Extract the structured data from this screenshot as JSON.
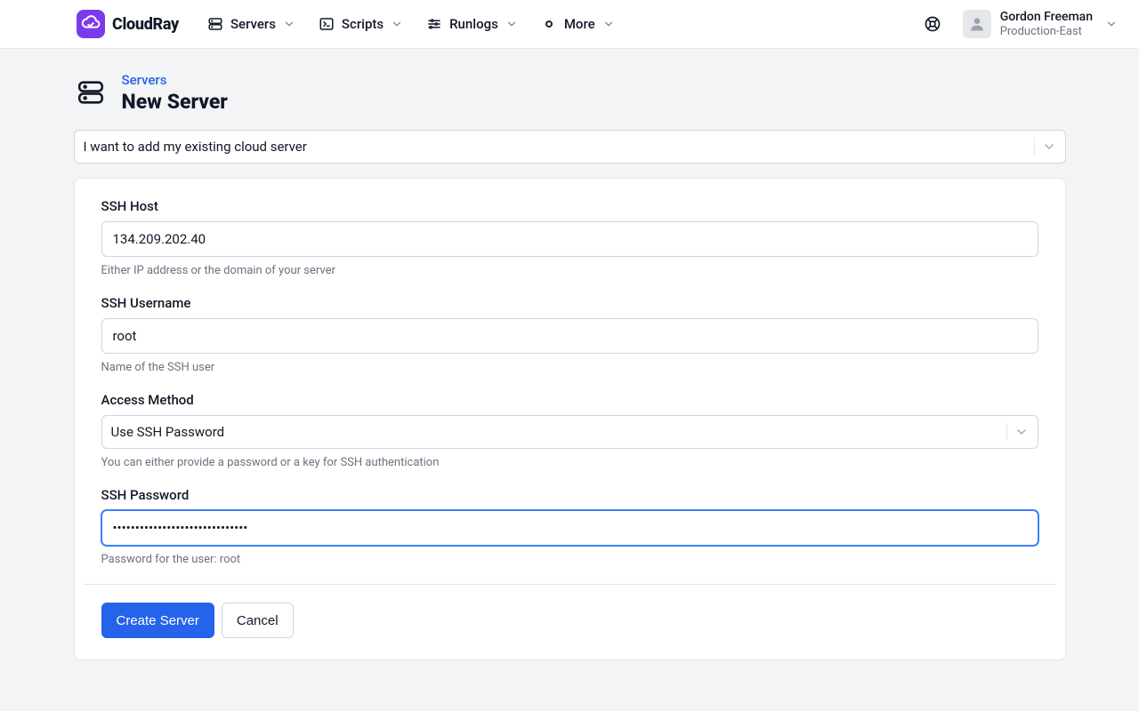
{
  "brand": {
    "name": "CloudRay"
  },
  "nav": {
    "servers": "Servers",
    "scripts": "Scripts",
    "runlogs": "Runlogs",
    "more": "More"
  },
  "user": {
    "name": "Gordon Freeman",
    "workspace": "Production-East"
  },
  "breadcrumb": {
    "servers": "Servers"
  },
  "page": {
    "title": "New Server"
  },
  "serverTypeSelector": {
    "value": "I want to add my existing cloud server"
  },
  "form": {
    "sshHost": {
      "label": "SSH Host",
      "value": "134.209.202.40",
      "help": "Either IP address or the domain of your server"
    },
    "sshUsername": {
      "label": "SSH Username",
      "value": "root",
      "help": "Name of the SSH user"
    },
    "accessMethod": {
      "label": "Access Method",
      "value": "Use SSH Password",
      "help": "You can either provide a password or a key for SSH authentication"
    },
    "sshPassword": {
      "label": "SSH Password",
      "value": "••••••••••••••••••••••••••••••",
      "help": "Password for the user: root"
    }
  },
  "actions": {
    "create": "Create Server",
    "cancel": "Cancel"
  }
}
